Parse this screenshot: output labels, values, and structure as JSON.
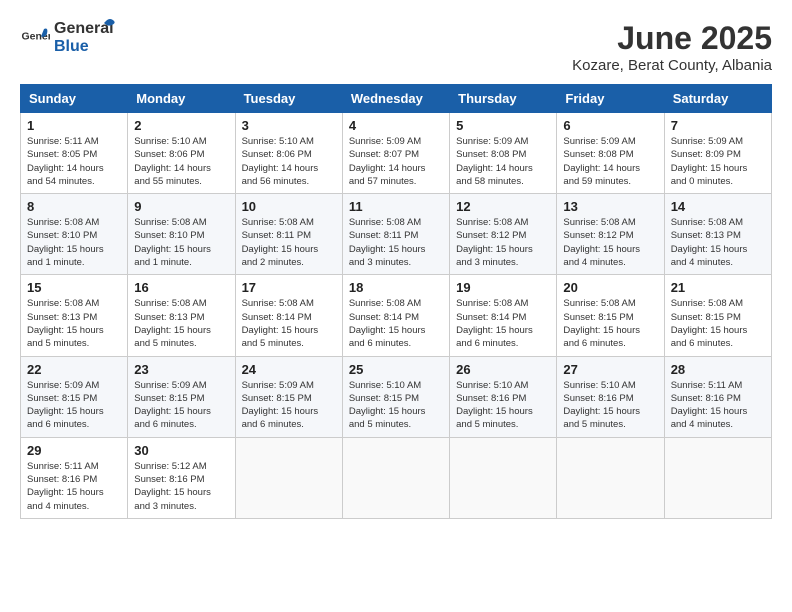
{
  "header": {
    "logo_general": "General",
    "logo_blue": "Blue",
    "month": "June 2025",
    "location": "Kozare, Berat County, Albania"
  },
  "weekdays": [
    "Sunday",
    "Monday",
    "Tuesday",
    "Wednesday",
    "Thursday",
    "Friday",
    "Saturday"
  ],
  "weeks": [
    [
      {
        "day": 1,
        "info": "Sunrise: 5:11 AM\nSunset: 8:05 PM\nDaylight: 14 hours\nand 54 minutes."
      },
      {
        "day": 2,
        "info": "Sunrise: 5:10 AM\nSunset: 8:06 PM\nDaylight: 14 hours\nand 55 minutes."
      },
      {
        "day": 3,
        "info": "Sunrise: 5:10 AM\nSunset: 8:06 PM\nDaylight: 14 hours\nand 56 minutes."
      },
      {
        "day": 4,
        "info": "Sunrise: 5:09 AM\nSunset: 8:07 PM\nDaylight: 14 hours\nand 57 minutes."
      },
      {
        "day": 5,
        "info": "Sunrise: 5:09 AM\nSunset: 8:08 PM\nDaylight: 14 hours\nand 58 minutes."
      },
      {
        "day": 6,
        "info": "Sunrise: 5:09 AM\nSunset: 8:08 PM\nDaylight: 14 hours\nand 59 minutes."
      },
      {
        "day": 7,
        "info": "Sunrise: 5:09 AM\nSunset: 8:09 PM\nDaylight: 15 hours\nand 0 minutes."
      }
    ],
    [
      {
        "day": 8,
        "info": "Sunrise: 5:08 AM\nSunset: 8:10 PM\nDaylight: 15 hours\nand 1 minute."
      },
      {
        "day": 9,
        "info": "Sunrise: 5:08 AM\nSunset: 8:10 PM\nDaylight: 15 hours\nand 1 minute."
      },
      {
        "day": 10,
        "info": "Sunrise: 5:08 AM\nSunset: 8:11 PM\nDaylight: 15 hours\nand 2 minutes."
      },
      {
        "day": 11,
        "info": "Sunrise: 5:08 AM\nSunset: 8:11 PM\nDaylight: 15 hours\nand 3 minutes."
      },
      {
        "day": 12,
        "info": "Sunrise: 5:08 AM\nSunset: 8:12 PM\nDaylight: 15 hours\nand 3 minutes."
      },
      {
        "day": 13,
        "info": "Sunrise: 5:08 AM\nSunset: 8:12 PM\nDaylight: 15 hours\nand 4 minutes."
      },
      {
        "day": 14,
        "info": "Sunrise: 5:08 AM\nSunset: 8:13 PM\nDaylight: 15 hours\nand 4 minutes."
      }
    ],
    [
      {
        "day": 15,
        "info": "Sunrise: 5:08 AM\nSunset: 8:13 PM\nDaylight: 15 hours\nand 5 minutes."
      },
      {
        "day": 16,
        "info": "Sunrise: 5:08 AM\nSunset: 8:13 PM\nDaylight: 15 hours\nand 5 minutes."
      },
      {
        "day": 17,
        "info": "Sunrise: 5:08 AM\nSunset: 8:14 PM\nDaylight: 15 hours\nand 5 minutes."
      },
      {
        "day": 18,
        "info": "Sunrise: 5:08 AM\nSunset: 8:14 PM\nDaylight: 15 hours\nand 6 minutes."
      },
      {
        "day": 19,
        "info": "Sunrise: 5:08 AM\nSunset: 8:14 PM\nDaylight: 15 hours\nand 6 minutes."
      },
      {
        "day": 20,
        "info": "Sunrise: 5:08 AM\nSunset: 8:15 PM\nDaylight: 15 hours\nand 6 minutes."
      },
      {
        "day": 21,
        "info": "Sunrise: 5:08 AM\nSunset: 8:15 PM\nDaylight: 15 hours\nand 6 minutes."
      }
    ],
    [
      {
        "day": 22,
        "info": "Sunrise: 5:09 AM\nSunset: 8:15 PM\nDaylight: 15 hours\nand 6 minutes."
      },
      {
        "day": 23,
        "info": "Sunrise: 5:09 AM\nSunset: 8:15 PM\nDaylight: 15 hours\nand 6 minutes."
      },
      {
        "day": 24,
        "info": "Sunrise: 5:09 AM\nSunset: 8:15 PM\nDaylight: 15 hours\nand 6 minutes."
      },
      {
        "day": 25,
        "info": "Sunrise: 5:10 AM\nSunset: 8:15 PM\nDaylight: 15 hours\nand 5 minutes."
      },
      {
        "day": 26,
        "info": "Sunrise: 5:10 AM\nSunset: 8:16 PM\nDaylight: 15 hours\nand 5 minutes."
      },
      {
        "day": 27,
        "info": "Sunrise: 5:10 AM\nSunset: 8:16 PM\nDaylight: 15 hours\nand 5 minutes."
      },
      {
        "day": 28,
        "info": "Sunrise: 5:11 AM\nSunset: 8:16 PM\nDaylight: 15 hours\nand 4 minutes."
      }
    ],
    [
      {
        "day": 29,
        "info": "Sunrise: 5:11 AM\nSunset: 8:16 PM\nDaylight: 15 hours\nand 4 minutes."
      },
      {
        "day": 30,
        "info": "Sunrise: 5:12 AM\nSunset: 8:16 PM\nDaylight: 15 hours\nand 3 minutes."
      },
      {
        "day": null,
        "info": ""
      },
      {
        "day": null,
        "info": ""
      },
      {
        "day": null,
        "info": ""
      },
      {
        "day": null,
        "info": ""
      },
      {
        "day": null,
        "info": ""
      }
    ]
  ]
}
